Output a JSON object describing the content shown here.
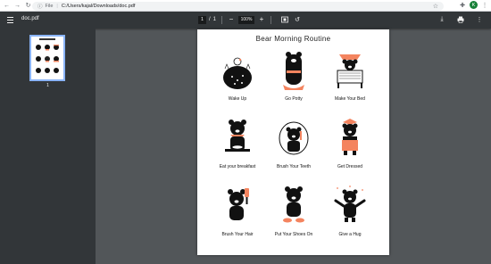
{
  "browser": {
    "file_label": "File",
    "url": "C:/Users/kajal/Downloads/doc.pdf",
    "avatar_letter": "K",
    "accent": "#188038"
  },
  "toolbar": {
    "doc_title": "doc.pdf",
    "page_current": "1",
    "page_sep": "/",
    "page_total": "1",
    "zoom_out": "−",
    "zoom_value": "100%",
    "zoom_in": "+"
  },
  "sidebar": {
    "thumb_number": "1"
  },
  "document": {
    "title": "Bear Morning Routine",
    "accent": "#f4845f",
    "items": [
      {
        "label": "Wake Up"
      },
      {
        "label": "Go Potty"
      },
      {
        "label": "Make Your Bed"
      },
      {
        "label": "Eat your breakfast"
      },
      {
        "label": "Brush Your Teeth"
      },
      {
        "label": "Get Dressed"
      },
      {
        "label": "Brush Your Hair"
      },
      {
        "label": "Put Your Shoes On"
      },
      {
        "label": "Give a Hug"
      }
    ]
  }
}
